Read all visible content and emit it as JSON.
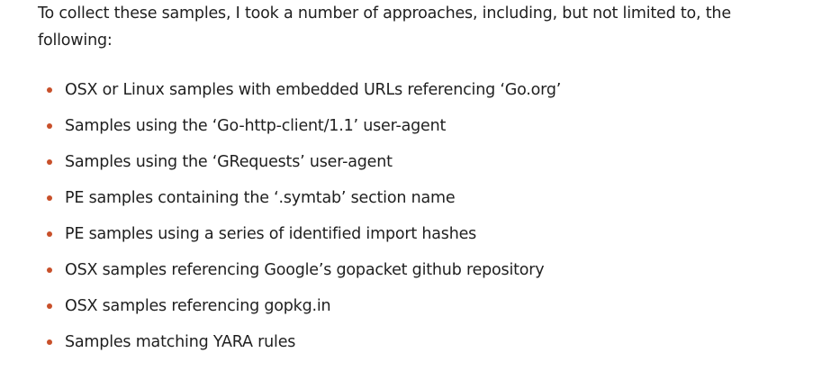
{
  "article": {
    "intro": "To collect these samples, I took a number of approaches, including, but not limited to, the following:",
    "bullet_color": "#c8502a",
    "items": [
      "OSX or Linux samples with embedded URLs referencing ‘Go.org’",
      "Samples using the ‘Go-http-client/1.1’ user-agent",
      "Samples using the ‘GRequests’ user-agent",
      "PE samples containing the ‘.symtab’ section name",
      "PE samples using a series of identified import hashes",
      "OSX samples referencing Google’s gopacket github repository",
      "OSX samples referencing gopkg.in",
      "Samples matching YARA rules"
    ]
  }
}
